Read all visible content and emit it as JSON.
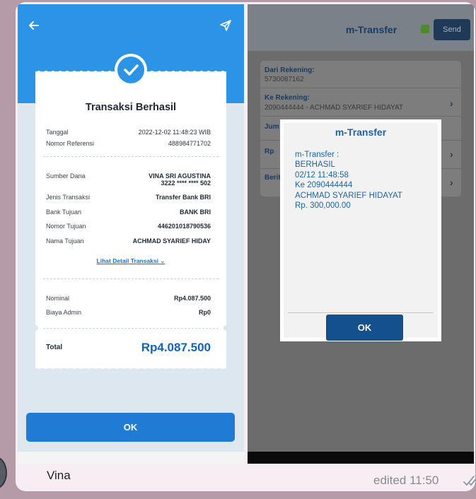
{
  "left": {
    "title": "Transaksi Berhasil",
    "tanggal_label": "Tanggal",
    "tanggal_value": "2022-12-02 11:48:23 WIB",
    "ref_label": "Nomor Referensi",
    "ref_value": "488984771702",
    "sumber_label": "Sumber Dana",
    "sumber_name": "VINA SRI AGUSTINA",
    "sumber_acct": "3222 **** **** 502",
    "jenis_label": "Jenis Transaksi",
    "jenis_value": "Transfer Bank BRI",
    "bank_label": "Bank Tujuan",
    "bank_value": "BANK BRI",
    "nomor_label": "Nomor Tujuan",
    "nomor_value": "446201018790536",
    "nama_label": "Nama Tujuan",
    "nama_value": "ACHMAD SYARIEF HIDAY",
    "detail_link": "Lihat Detail Transaksi",
    "nominal_label": "Nominal",
    "nominal_value": "Rp4.087.500",
    "admin_label": "Biaya Admin",
    "admin_value": "Rp0",
    "total_label": "Total",
    "total_value": "Rp4.087.500",
    "ok_label": "OK"
  },
  "right": {
    "app_title": "m-Transfer",
    "send_label": "Send",
    "dari_label": "Dari Rekening:",
    "dari_value": "5730087162",
    "ke_label": "Ke Rekening:",
    "ke_value": "2090444444 - ACHMAD SYARIEF HIDAYAT",
    "jum_label": "Jum",
    "rp_label": "Rp",
    "berit_label": "Berit",
    "dialog": {
      "title": "m-Transfer",
      "lines": [
        "m-Transfer :",
        "BERHASIL",
        "02/12 11:48:58",
        "Ke 2090444444",
        "ACHMAD SYARIEF HIDAYAT",
        "Rp. 300,000.00"
      ],
      "ok_label": "OK"
    }
  },
  "message": {
    "sender": "Vina",
    "meta": "edited 11:50"
  },
  "colors": {
    "brand_blue": "#2b94e6",
    "ok_blue": "#1f7bd3",
    "total_blue": "#1363b8",
    "dialog_blue": "#1e64a8"
  }
}
